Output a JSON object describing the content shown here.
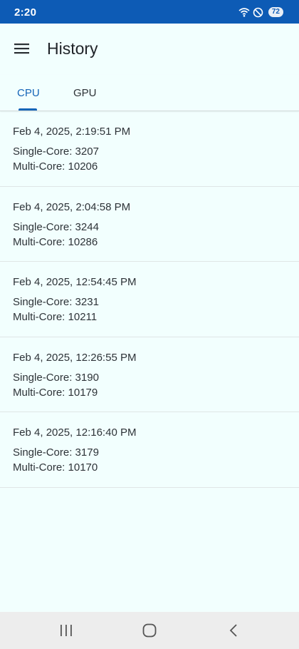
{
  "status_bar": {
    "time": "2:20",
    "battery": "72",
    "icons": [
      "wifi-icon",
      "do-not-disturb-icon",
      "battery-icon"
    ]
  },
  "app_bar": {
    "title": "History",
    "menu_icon": "hamburger-menu-icon"
  },
  "tabs": [
    {
      "label": "CPU",
      "selected": true
    },
    {
      "label": "GPU",
      "selected": false
    }
  ],
  "history": [
    {
      "date": "Feb 4, 2025, 2:19:51 PM",
      "single": "Single-Core: 3207",
      "multi": "Multi-Core: 10206"
    },
    {
      "date": "Feb 4, 2025, 2:04:58 PM",
      "single": "Single-Core: 3244",
      "multi": "Multi-Core: 10286"
    },
    {
      "date": "Feb 4, 2025, 12:54:45 PM",
      "single": "Single-Core: 3231",
      "multi": "Multi-Core: 10211"
    },
    {
      "date": "Feb 4, 2025, 12:26:55 PM",
      "single": "Single-Core: 3190",
      "multi": "Multi-Core: 10179"
    },
    {
      "date": "Feb 4, 2025, 12:16:40 PM",
      "single": "Single-Core: 3179",
      "multi": "Multi-Core: 10170"
    }
  ],
  "nav_bar": {
    "icons": [
      "recent-apps-icon",
      "home-icon",
      "back-icon"
    ]
  },
  "colors": {
    "status_bar": "#0d5bb5",
    "background": "#f2fffe",
    "accent": "#1565b8"
  }
}
